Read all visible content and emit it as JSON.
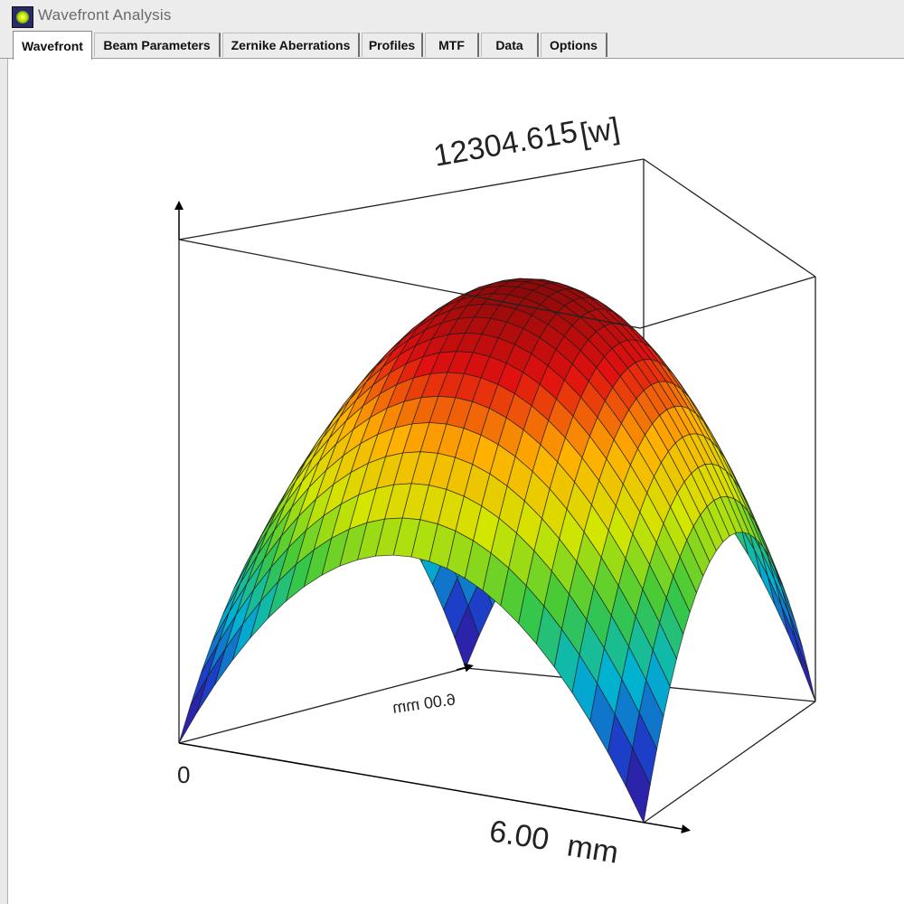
{
  "window": {
    "title": "Wavefront Analysis",
    "icon": "wavefront-app-icon"
  },
  "tabs": [
    {
      "label": "Wavefront",
      "active": true
    },
    {
      "label": "Beam Parameters",
      "active": false
    },
    {
      "label": "Zernike Aberrations",
      "active": false
    },
    {
      "label": "Profiles",
      "active": false
    },
    {
      "label": "MTF",
      "active": false
    },
    {
      "label": "Data",
      "active": false
    },
    {
      "label": "Options",
      "active": false
    }
  ],
  "plot": {
    "type": "3d-surface",
    "z_max_label": "12304.615",
    "z_unit_label": "[w]",
    "origin_label": "0",
    "x_max_label": "6.00",
    "x_unit_label": "mm",
    "y_axis_label": "6.00 mm",
    "y_axis_label_mirrored": true,
    "surface_shape": "inverted paraboloid dome",
    "colormap": [
      "#3a0a8a",
      "#1e3cc8",
      "#00b4d0",
      "#3cc83c",
      "#d2e600",
      "#ffb000",
      "#e01010",
      "#8a0a0a"
    ],
    "grid": true
  }
}
